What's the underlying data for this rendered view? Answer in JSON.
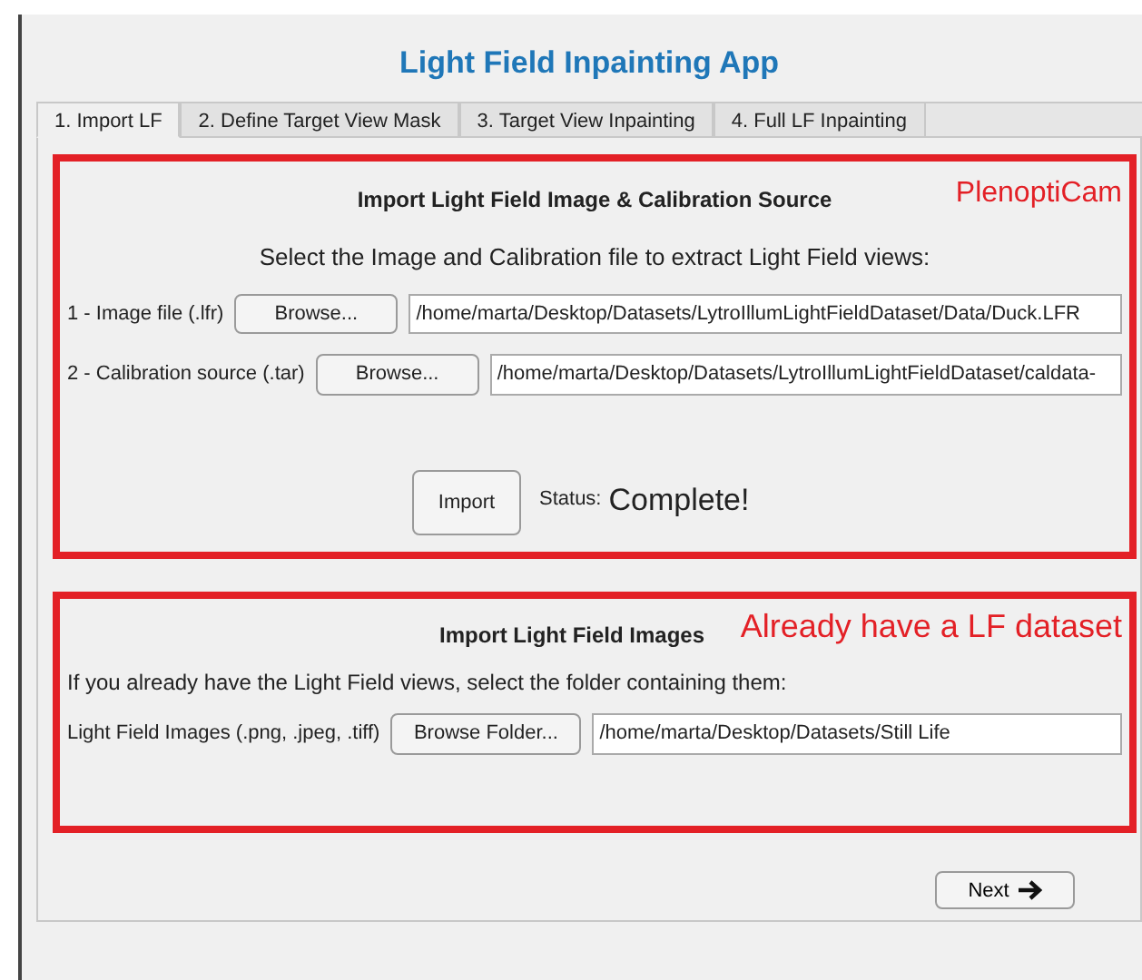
{
  "window": {
    "title": "Light Field Inpainting App"
  },
  "tabs": [
    {
      "label": "1. Import LF",
      "selected": true
    },
    {
      "label": "2. Define Target View Mask",
      "selected": false
    },
    {
      "label": "3. Target View Inpainting",
      "selected": false
    },
    {
      "label": "4. Full LF Inpainting",
      "selected": false
    }
  ],
  "plenopticam_panel": {
    "heading": "Import Light Field Image & Calibration Source",
    "annotation": "PlenoptiCam",
    "instruction": "Select the Image and Calibration file to extract Light Field views:",
    "rows": [
      {
        "label": "1 - Image file (.lfr)",
        "button": "Browse...",
        "value": "/home/marta/Desktop/Datasets/LytroIllumLightFieldDataset/Data/Duck.LFR"
      },
      {
        "label": "2 - Calibration source (.tar)",
        "button": "Browse...",
        "value": "/home/marta/Desktop/Datasets/LytroIllumLightFieldDataset/caldata-"
      }
    ],
    "import_button": "Import",
    "status_label": "Status:",
    "status_value": "Complete!"
  },
  "dataset_panel": {
    "heading": "Import Light Field Images",
    "annotation": "Already have a LF dataset",
    "instruction": "If you already have the Light Field views, select the folder containing them:",
    "rows": [
      {
        "label": "Light Field Images (.png, .jpeg, .tiff)",
        "button": "Browse Folder...",
        "value": "/home/marta/Desktop/Datasets/Still Life"
      }
    ]
  },
  "next_button": {
    "label": "Next"
  }
}
